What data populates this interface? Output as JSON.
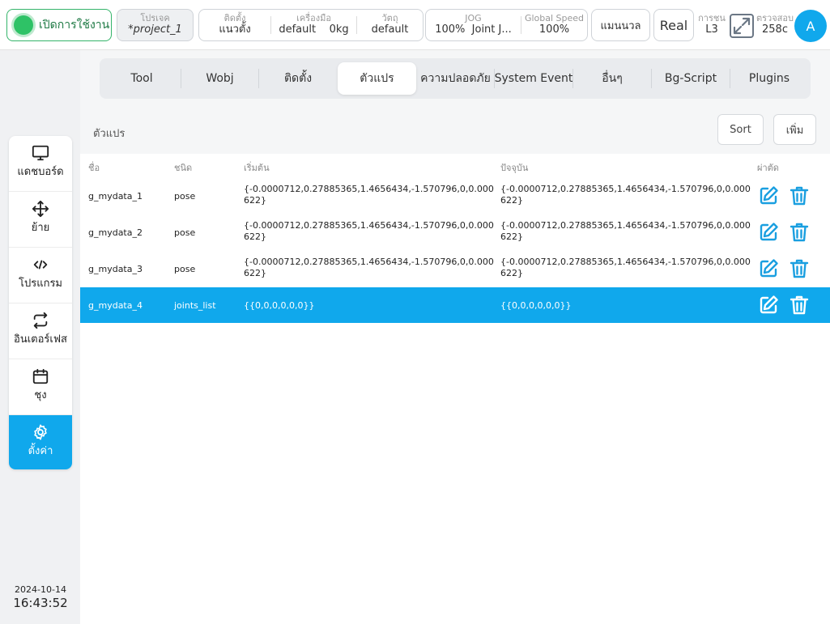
{
  "topbar": {
    "enable_label": "เปิดการใช้งาน",
    "project": {
      "label": "โปรเจค",
      "value": "*project_1"
    },
    "install": {
      "label": "ติดตั้ง",
      "value": "แนวตั้ง"
    },
    "tool": {
      "label": "เครื่องมือ",
      "value": "default",
      "mass": "0kg"
    },
    "object": {
      "label": "วัตถุ",
      "value": "default"
    },
    "jog": {
      "label": "JOG",
      "speed": "100%",
      "mode": "Joint J..."
    },
    "global_speed": {
      "label": "Global Speed",
      "value": "100%"
    },
    "manual_label": "แมนนวล",
    "real_label": "Real",
    "collision": {
      "label": "การชน",
      "value": "L3"
    },
    "check": {
      "label": "ตรวจสอบ",
      "value": "258c"
    },
    "avatar": "A"
  },
  "sidebar": {
    "items": [
      {
        "label": "แดชบอร์ด",
        "icon": "monitor-icon"
      },
      {
        "label": "ย้าย",
        "icon": "move-icon"
      },
      {
        "label": "โปรแกรม",
        "icon": "code-icon"
      },
      {
        "label": "อินเตอร์เฟส",
        "icon": "interface-icon"
      },
      {
        "label": "ชุง",
        "icon": "calendar-icon"
      },
      {
        "label": "ตั้งค่า",
        "icon": "gear-icon",
        "active": true
      }
    ],
    "date": "2024-10-14",
    "time": "16:43:52"
  },
  "tabs": [
    "Tool",
    "Wobj",
    "ติดตั้ง",
    "ตัวแปร",
    "ความปลอดภัย",
    "System Event",
    "อื่นๆ",
    "Bg-Script",
    "Plugins"
  ],
  "active_tab": "ตัวแปร",
  "section": {
    "title": "ตัวแปร",
    "sort_label": "Sort",
    "add_label": "เพิ่ม"
  },
  "table": {
    "headers": {
      "name": "ชื่อ",
      "type": "ชนิด",
      "initial": "เริ่มต้น",
      "current": "ปัจจุบัน",
      "actions": "ผ่าตัด"
    },
    "rows": [
      {
        "name": "g_mydata_1",
        "type": "pose",
        "initial": "{-0.0000712,0.27885365,1.4656434,-1.570796,0,0.000622}",
        "current": "{-0.0000712,0.27885365,1.4656434,-1.570796,0,0.000622}"
      },
      {
        "name": "g_mydata_2",
        "type": "pose",
        "initial": "{-0.0000712,0.27885365,1.4656434,-1.570796,0,0.000622}",
        "current": "{-0.0000712,0.27885365,1.4656434,-1.570796,0,0.000622}"
      },
      {
        "name": "g_mydata_3",
        "type": "pose",
        "initial": "{-0.0000712,0.27885365,1.4656434,-1.570796,0,0.000622}",
        "current": "{-0.0000712,0.27885365,1.4656434,-1.570796,0,0.000622}"
      },
      {
        "name": "g_mydata_4",
        "type": "joints_list",
        "initial": "{{0,0,0,0,0,0}}",
        "current": "{{0,0,0,0,0,0}}",
        "selected": true
      }
    ]
  },
  "colors": {
    "accent": "#10a8ec",
    "enabled": "#2ec266",
    "icon_blue": "#1a9fe0"
  }
}
